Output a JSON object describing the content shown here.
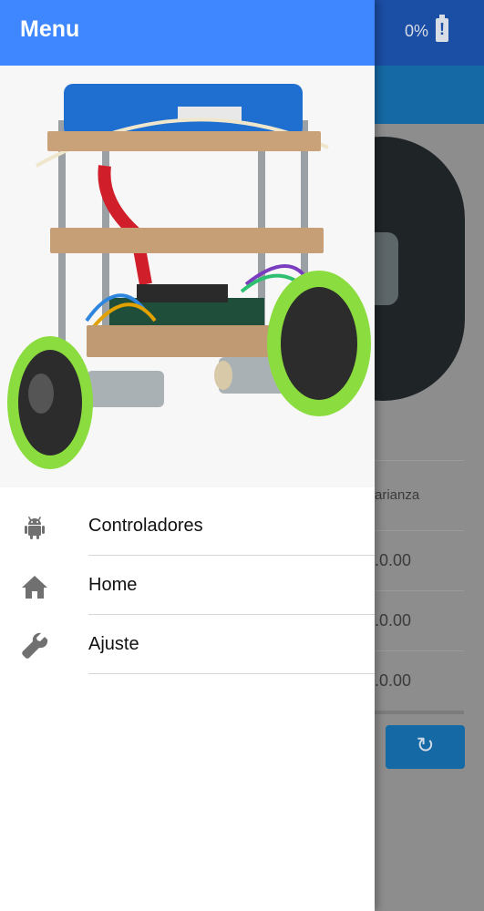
{
  "background": {
    "battery_text": "0%",
    "table_header": "arianza",
    "values": [
      ".0.00",
      ".0.00",
      ".0.00"
    ]
  },
  "drawer": {
    "title": "Menu",
    "items": [
      {
        "label": "Controladores",
        "icon": "android-icon"
      },
      {
        "label": "Home",
        "icon": "home-icon"
      },
      {
        "label": "Ajuste",
        "icon": "wrench-icon"
      }
    ]
  }
}
